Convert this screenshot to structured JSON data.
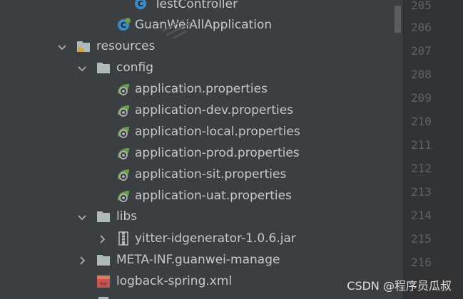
{
  "project_tree": {
    "items": [
      {
        "label": "TestController",
        "kind": "class"
      },
      {
        "label": "GuanWeiAllApplication",
        "kind": "spring-class"
      },
      {
        "label": "resources",
        "kind": "folder-expanded"
      },
      {
        "label": "config",
        "kind": "folder-expanded"
      },
      {
        "label": "application.properties",
        "kind": "spring-properties"
      },
      {
        "label": "application-dev.properties",
        "kind": "spring-properties"
      },
      {
        "label": "application-local.properties",
        "kind": "spring-properties"
      },
      {
        "label": "application-prod.properties",
        "kind": "spring-properties"
      },
      {
        "label": "application-sit.properties",
        "kind": "spring-properties"
      },
      {
        "label": "application-uat.properties",
        "kind": "spring-properties"
      },
      {
        "label": "libs",
        "kind": "folder-expanded"
      },
      {
        "label": "yitter-idgenerator-1.0.6.jar",
        "kind": "jar-collapsed"
      },
      {
        "label": "META-INF.guanwei-manage",
        "kind": "folder-collapsed"
      },
      {
        "label": "logback-spring.xml",
        "kind": "xml"
      }
    ]
  },
  "gutter": {
    "line_numbers": [
      "205",
      "206",
      "207",
      "208",
      "209",
      "210",
      "211",
      "212",
      "213",
      "214",
      "215",
      "216"
    ]
  },
  "watermark": {
    "text": "CSDN @程序员瓜叔"
  },
  "colors": {
    "panel_bg": "#3c3f41",
    "gutter_bg": "#313335",
    "text": "#c8c8c8",
    "folder": "#aeb9c0",
    "spring_green": "#6a9e4f",
    "class_blue": "#3d8ac7"
  }
}
